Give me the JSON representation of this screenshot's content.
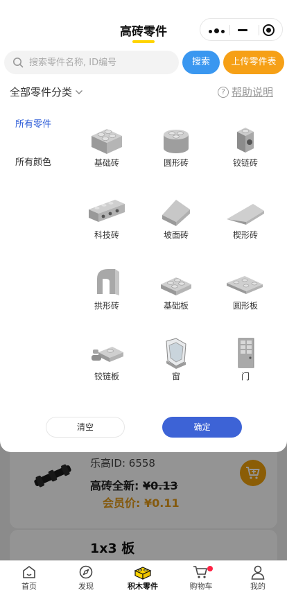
{
  "header": {
    "title": "高砖零件",
    "underline_color": "#ffd400"
  },
  "search": {
    "placeholder": "搜索零件名称, ID编号",
    "button_label": "搜索",
    "upload_label": "上传零件表"
  },
  "filter": {
    "category_label": "全部零件分类",
    "help_label": "帮助说明",
    "side_items": [
      {
        "label": "所有零件",
        "active": true
      },
      {
        "label": "所有颜色",
        "active": false
      }
    ],
    "parts": [
      {
        "label": "基础砖",
        "icon": "basic-brick-icon"
      },
      {
        "label": "圆形砖",
        "icon": "round-brick-icon"
      },
      {
        "label": "铰链砖",
        "icon": "hinge-brick-icon"
      },
      {
        "label": "科技砖",
        "icon": "technic-brick-icon"
      },
      {
        "label": "坡面砖",
        "icon": "slope-brick-icon"
      },
      {
        "label": "楔形砖",
        "icon": "wedge-brick-icon"
      },
      {
        "label": "拱形砖",
        "icon": "arch-brick-icon"
      },
      {
        "label": "基础板",
        "icon": "basic-plate-icon"
      },
      {
        "label": "圆形板",
        "icon": "round-plate-icon"
      },
      {
        "label": "铰链板",
        "icon": "hinge-plate-icon"
      },
      {
        "label": "窗",
        "icon": "window-icon"
      },
      {
        "label": "门",
        "icon": "door-icon"
      }
    ],
    "clear_label": "清空",
    "confirm_label": "确定",
    "accent_color": "#3d63d6"
  },
  "product": {
    "id_text": "乐高ID: 6558",
    "new_price_prefix": "高砖全新: ",
    "new_price": "¥0.13",
    "member_price": "会员价: ¥0.11",
    "next_title": "1x3 板"
  },
  "tabbar": {
    "items": [
      {
        "label": "首页",
        "icon": "home-icon"
      },
      {
        "label": "发现",
        "icon": "compass-icon"
      },
      {
        "label": "积木零件",
        "icon": "brick-icon",
        "active": true
      },
      {
        "label": "购物车",
        "icon": "cart-icon",
        "badge": true
      },
      {
        "label": "我的",
        "icon": "user-icon"
      }
    ]
  }
}
